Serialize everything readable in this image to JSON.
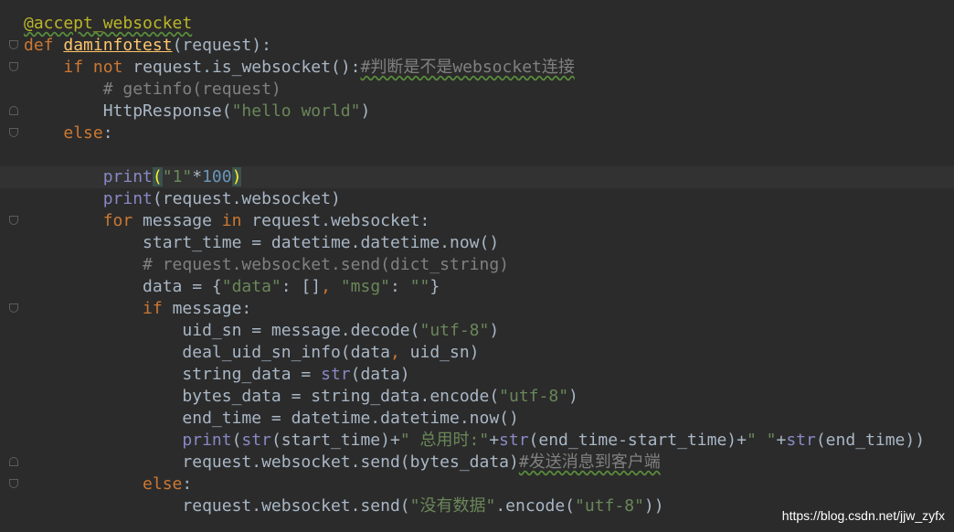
{
  "colors": {
    "background": "#2b2b2b",
    "keyword": "#cc7832",
    "function_name": "#ffc66d",
    "decorator": "#bbb529",
    "string": "#6a8759",
    "number": "#6897bb",
    "comment": "#808080",
    "builtin": "#8888c6",
    "default_text": "#a9b7c6"
  },
  "code": {
    "l1": {
      "decorator": "@accept_websocket"
    },
    "l2": {
      "kw_def": "def",
      "space": " ",
      "fn": "daminfotest",
      "rest": "(request):"
    },
    "l3": {
      "indent": "    ",
      "kw_if": "if",
      "sp1": " ",
      "kw_not": "not",
      "rest": " request.is_websocket():",
      "comment": "#判断是不是websocket连接"
    },
    "l4": {
      "indent": "        ",
      "comment": "# getinfo(request)"
    },
    "l5": {
      "indent": "        ",
      "call": "HttpResponse(",
      "str": "\"hello world\"",
      "close": ")"
    },
    "l6": {
      "indent": "    ",
      "kw_else": "else",
      "colon": ":"
    },
    "l7": {
      "text": ""
    },
    "l8": {
      "indent": "        ",
      "bi": "print",
      "open": "(",
      "str": "\"1\"",
      "op": "*",
      "num": "100",
      "close": ")"
    },
    "l9": {
      "indent": "        ",
      "bi": "print",
      "rest": "(request.websocket)"
    },
    "l10": {
      "indent": "        ",
      "kw_for": "for",
      "mid": " message ",
      "kw_in": "in",
      "rest": " request.websocket:"
    },
    "l11": {
      "indent": "            ",
      "text": "start_time = datetime.datetime.now()"
    },
    "l12": {
      "indent": "            ",
      "comment": "# request.websocket.send(dict_string)"
    },
    "l13": {
      "indent": "            ",
      "a": "data = {",
      "s1": "\"data\"",
      "b": ": []",
      "comma": ",",
      "c": " ",
      "s2": "\"msg\"",
      "d": ": ",
      "s3": "\"\"",
      "e": "}"
    },
    "l14": {
      "indent": "            ",
      "kw_if": "if",
      "rest": " message:"
    },
    "l15": {
      "indent": "                ",
      "a": "uid_sn = message.decode(",
      "str": "\"utf-8\"",
      "b": ")"
    },
    "l16": {
      "indent": "                ",
      "a": "deal_uid_sn_info(data",
      "comma": ",",
      "b": " uid_sn)"
    },
    "l17": {
      "indent": "                ",
      "a": "string_data = ",
      "bi": "str",
      "b": "(data)"
    },
    "l18": {
      "indent": "                ",
      "a": "bytes_data = string_data.encode(",
      "str": "\"utf-8\"",
      "b": ")"
    },
    "l19": {
      "indent": "                ",
      "text": "end_time = datetime.datetime.now()"
    },
    "l20": {
      "indent": "                ",
      "bi1": "print",
      "a": "(",
      "bi2": "str",
      "b": "(start_time)+",
      "str1": "\" 总用时:\"",
      "c": "+",
      "bi3": "str",
      "d": "(end_time-start_time)+",
      "str2": "\" \"",
      "e": "+",
      "bi4": "str",
      "f": "(end_time))"
    },
    "l21": {
      "indent": "                ",
      "a": "request.websocket.send(bytes_data)",
      "comment": "#发送消息到客户端"
    },
    "l22": {
      "indent": "            ",
      "kw_else": "else",
      "colon": ":"
    },
    "l23": {
      "indent": "                ",
      "a": "request.websocket.send(",
      "str1": "\"没有数据\"",
      "b": ".encode(",
      "str2": "\"utf-8\"",
      "c": "))"
    }
  },
  "watermark": "https://blog.csdn.net/jjw_zyfx"
}
